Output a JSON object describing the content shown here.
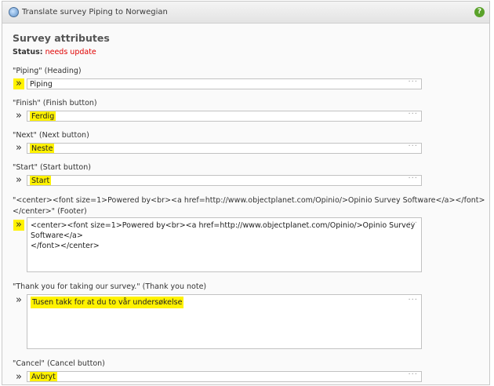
{
  "window": {
    "title": "Translate survey Piping to Norwegian",
    "help": "?"
  },
  "section": {
    "title": "Survey attributes",
    "status_label": "Status:",
    "status_value": "needs update"
  },
  "fields": [
    {
      "label": "\"Piping\" (Heading)",
      "value": "Piping",
      "highlighted_value": false
    },
    {
      "label": "\"Finish\" (Finish button)",
      "value": "Ferdig",
      "highlighted_value": true
    },
    {
      "label": "\"Next\" (Next button)",
      "value": "Neste",
      "highlighted_value": true
    },
    {
      "label": "\"Start\" (Start button)",
      "value": "Start",
      "highlighted_value": true
    },
    {
      "label_line1": "\"<center><font size=1>Powered by<br><a href=http://www.objectplanet.com/Opinio/>Opinio Survey Software</a></font>",
      "label_line2": "</center>\" (Footer)",
      "value_line1": "<center><font size=1>Powered by<br><a href=http://www.objectplanet.com/Opinio/>Opinio Survey Software</a>",
      "value_line2": "</font></center>"
    },
    {
      "label": "\"Thank you for taking our survey.\" (Thank you note)",
      "value": "Tusen takk for at du to vår undersøkelse"
    },
    {
      "label": "\"Cancel\" (Cancel button)",
      "value": "Avbryt"
    }
  ],
  "expand_glyph": "»",
  "resize_glyph": "···",
  "colors": {
    "highlight": "#fff200",
    "status": "#e00000"
  }
}
